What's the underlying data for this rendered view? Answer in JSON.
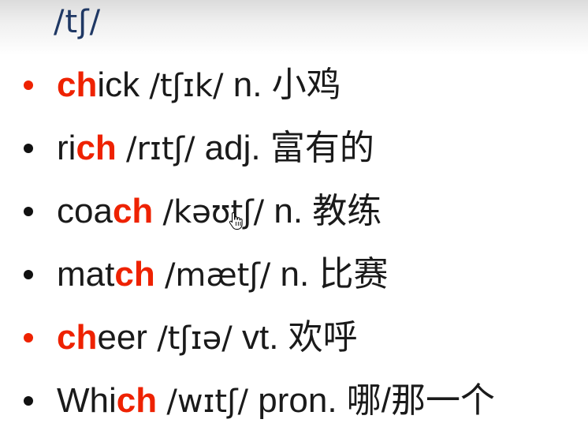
{
  "heading": "/tʃ/",
  "colors": {
    "heading": "#1f3864",
    "highlight": "#ee2200",
    "text": "#1a1a1a"
  },
  "words": [
    {
      "bullet_color": "red",
      "pre": "",
      "hl": "ch",
      "post": "ick",
      "ipa": "/tʃɪk/",
      "pos": "n.",
      "meaning": "小鸡"
    },
    {
      "bullet_color": "black",
      "pre": "ri",
      "hl": "ch",
      "post": "",
      "ipa": "/rɪtʃ/",
      "pos": "adj.",
      "meaning": "富有的"
    },
    {
      "bullet_color": "black",
      "pre": "coa",
      "hl": "ch",
      "post": "",
      "ipa": "/kəʊtʃ/",
      "pos": "n.",
      "meaning": "教练"
    },
    {
      "bullet_color": "black",
      "pre": "mat",
      "hl": "ch",
      "post": "",
      "ipa": "/mætʃ/",
      "pos": "n.",
      "meaning": "比赛"
    },
    {
      "bullet_color": "red",
      "pre": "",
      "hl": "ch",
      "post": "eer",
      "ipa": "/tʃɪə/",
      "pos": "vt.",
      "meaning": "欢呼"
    },
    {
      "bullet_color": "black",
      "pre": "Whi",
      "hl": "ch",
      "post": "",
      "ipa": "/wɪtʃ/",
      "pos": "pron.",
      "meaning": "哪/那一个"
    }
  ],
  "cursor_icon": "hand-pointer-icon"
}
